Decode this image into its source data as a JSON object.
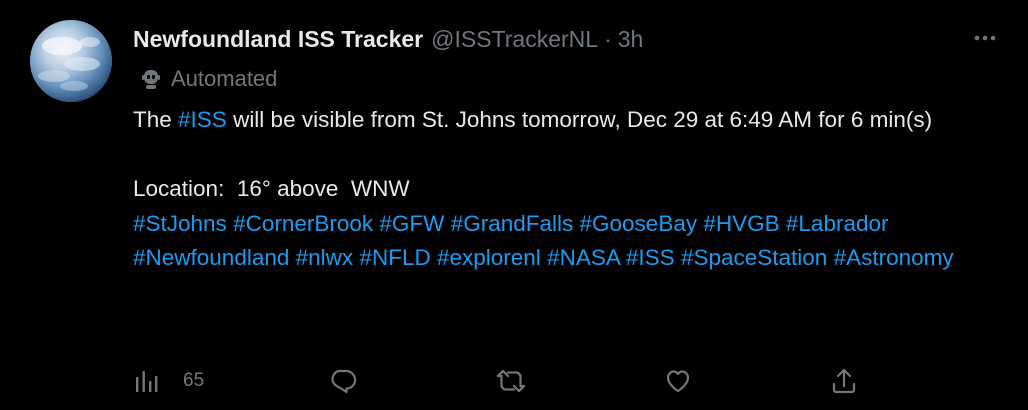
{
  "tweet": {
    "author_name": "Newfoundland ISS Tracker",
    "handle": "@ISSTrackerNL",
    "separator": "·",
    "time": "3h",
    "automated_label": "Automated",
    "body": {
      "line1_prefix": "The ",
      "line1_tag": "#ISS",
      "line1_rest": " will be visible from St. Johns tomorrow, Dec 29 at 6:49 AM for 6 min(s)",
      "location_text": "Location:  16° above  WNW",
      "hashtags": [
        "#StJohns",
        "#CornerBrook",
        "#GFW",
        "#GrandFalls",
        "#GooseBay",
        "#HVGB",
        "#Labrador",
        "#Newfoundland",
        "#nlwx",
        "#NFLD",
        "#explorenl",
        "#NASA",
        "#ISS",
        "#SpaceStation",
        "#Astronomy"
      ]
    },
    "actions": {
      "views_count": "65"
    }
  },
  "icons": {
    "more": "more-icon",
    "bot": "robot-icon",
    "views": "analytics-icon",
    "reply": "reply-icon",
    "retweet": "retweet-icon",
    "like": "heart-icon",
    "share": "share-icon"
  },
  "colors": {
    "background": "#000000",
    "text": "#e7e9ea",
    "muted": "#71767b",
    "accent": "#1d9bf0"
  }
}
